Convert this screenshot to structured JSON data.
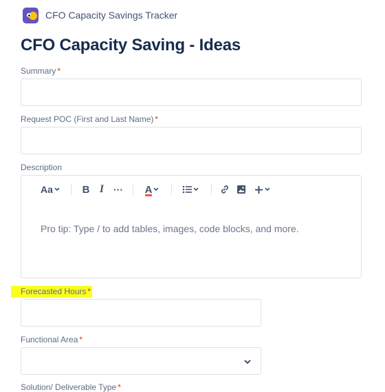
{
  "app": {
    "name": "CFO Capacity Savings Tracker"
  },
  "page": {
    "title": "CFO Capacity Saving - Ideas"
  },
  "form": {
    "summary": {
      "label": "Summary",
      "required": "*",
      "value": ""
    },
    "poc": {
      "label": "Request POC (First and Last Name)",
      "required": "*",
      "value": ""
    },
    "description": {
      "label": "Description",
      "placeholder": "Pro tip: Type / to add tables, images, code blocks, and more.",
      "toolbar": {
        "text_style": "Aa",
        "bold": "B",
        "italic": "I",
        "more": "···",
        "text_color": "A",
        "text_color_underline": "#ff5630"
      }
    },
    "forecasted_hours": {
      "label": "Forecasted Hours",
      "required": "*",
      "value": "",
      "highlight_color": "#fbff1f"
    },
    "functional_area": {
      "label": "Functional Area",
      "required": "*",
      "selected": ""
    },
    "solution_type": {
      "label": "Solution/ Deliverable Type",
      "required": "*"
    }
  },
  "colors": {
    "accent": "#6554c0",
    "required": "#de350b",
    "text": "#172b4d"
  }
}
